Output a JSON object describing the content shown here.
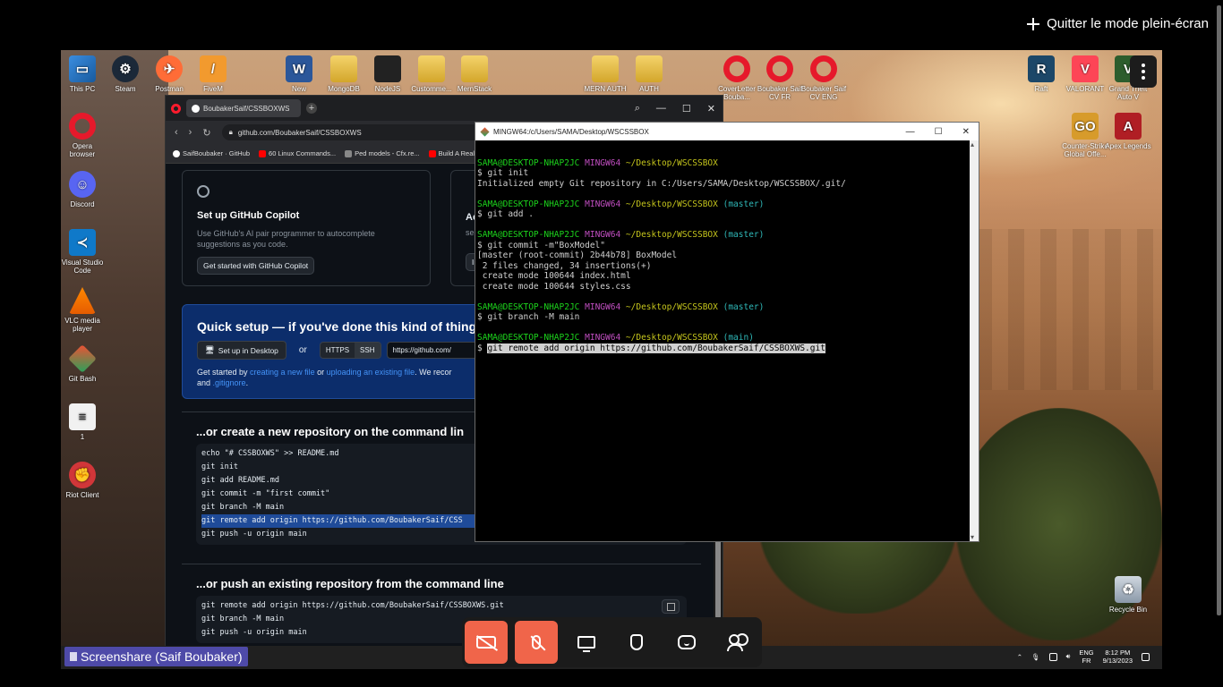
{
  "overlay": {
    "exit_fullscreen": "Quitter le mode plein-écran",
    "screenshare_label": "Screenshare (Saif Boubaker)"
  },
  "desktop_icons": {
    "top_row": [
      "This PC",
      "Steam",
      "Postman",
      "FiveM",
      "New",
      "MongoDB",
      "NodeJS",
      "Customme...",
      "MernStack",
      "MERN AUTH",
      "AUTH",
      "CoverLetter Bouba...",
      "Boubaker Saif CV FR",
      "Boubaker Saif CV ENG",
      "Raft",
      "VALORANT",
      "Grand Theft Auto V"
    ],
    "left_column": [
      "Opera browser",
      "Discord",
      "Visual Studio Code",
      "VLC media player",
      "Git Bash",
      "1",
      "Riot Client"
    ],
    "right_column": [
      "Counter-Strike Global Offe...",
      "Apex Legends",
      "Recycle Bin"
    ]
  },
  "browser": {
    "tab_title": "BoubakerSaif/CSSBOXWS",
    "url": "github.com/BoubakerSaif/CSSBOXWS",
    "bookmarks": [
      "SaifBoubaker · GitHub",
      "60 Linux Commands...",
      "Ped models - Cfx.re...",
      "Build A Real"
    ],
    "copilot": {
      "title": "Set up GitHub Copilot",
      "description": "Use GitHub's AI pair programmer to autocomplete suggestions as you code.",
      "button": "Get started with GitHub Copilot"
    },
    "card2_title": "Ac",
    "card2_text": "se",
    "card2_btn": "In",
    "quick_setup": {
      "title": "Quick setup — if you've done this kind of thing b",
      "desktop_btn": "Set up in Desktop",
      "or": "or",
      "https": "HTTPS",
      "ssh": "SSH",
      "url": "https://github.com/",
      "text_1": "Get started by ",
      "link_1": "creating a new file",
      "text_2": " or ",
      "link_2": "uploading an existing file",
      "text_3": ". We recor",
      "text_4": "and ",
      "link_3": ".gitignore",
      "text_5": "."
    },
    "new_repo": {
      "title": "...or create a new repository on the command lin",
      "lines": [
        "echo \"# CSSBOXWS\" >> README.md",
        "git init",
        "git add README.md",
        "git commit -m \"first commit\"",
        "git branch -M main",
        "git remote add origin https://github.com/BoubakerSaif/CSS",
        "git push -u origin main"
      ]
    },
    "push_existing": {
      "title": "...or push an existing repository from the command line",
      "lines": [
        "git remote add origin https://github.com/BoubakerSaif/CSSBOXWS.git",
        "git branch -M main",
        "git push -u origin main"
      ]
    }
  },
  "terminal": {
    "title": "MINGW64:/c/Users/SAMA/Desktop/WSCSSBOX",
    "user": "SAMA@DESKTOP-NHAP2JC",
    "env": "MINGW64",
    "path": "~/Desktop/WSCSSBOX",
    "branch_master": "(master)",
    "branch_main": "(main)",
    "cmd_init": "$ git init",
    "out_init": "Initialized empty Git repository in C:/Users/SAMA/Desktop/WSCSSBOX/.git/",
    "cmd_add": "$ git add .",
    "cmd_commit": "$ git commit -m\"BoxModel\"",
    "out_commit_1": "[master (root-commit) 2b44b78] BoxModel",
    "out_commit_2": " 2 files changed, 34 insertions(+)",
    "out_commit_3": " create mode 100644 index.html",
    "out_commit_4": " create mode 100644 styles.css",
    "cmd_branch": "$ git branch -M main",
    "prompt": "$ ",
    "cmd_remote": "git remote add origin https://github.com/BoubakerSaif/CSSBOXWS.git"
  },
  "taskbar": {
    "lang_1": "ENG",
    "lang_2": "FR",
    "time": "8:12 PM",
    "date": "9/13/2023"
  }
}
